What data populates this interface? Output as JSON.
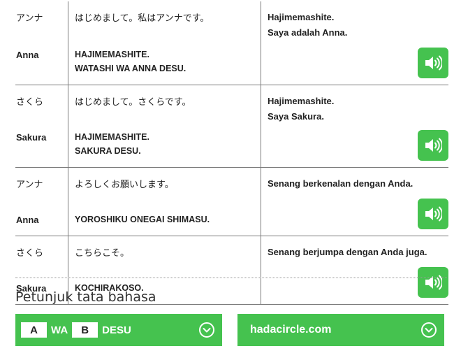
{
  "dialog": {
    "rows": [
      {
        "speaker_jp": "アンナ",
        "speaker_romaji": "Anna",
        "jp": "はじめまして。私はアンナです。",
        "romaji_line1": "HAJIMEMASHITE.",
        "romaji_line2": "WATASHI WA ANNA DESU.",
        "indonesian_line1": "Hajimemashite.",
        "indonesian_line2": "Saya adalah Anna."
      },
      {
        "speaker_jp": "さくら",
        "speaker_romaji": "Sakura",
        "jp": "はじめまして。さくらです。",
        "romaji_line1": "HAJIMEMASHITE.",
        "romaji_line2": "SAKURA DESU.",
        "indonesian_line1": "Hajimemashite.",
        "indonesian_line2": "Saya Sakura."
      },
      {
        "speaker_jp": "アンナ",
        "speaker_romaji": "Anna",
        "jp": "よろしくお願いします。",
        "romaji_line1": "YOROSHIKU ONEGAI SHIMASU.",
        "romaji_line2": "",
        "indonesian_line1": "Senang berkenalan dengan Anda.",
        "indonesian_line2": ""
      },
      {
        "speaker_jp": "さくら",
        "speaker_romaji": "Sakura",
        "jp": "こちらこそ。",
        "romaji_line1": "KOCHIRAKOSO.",
        "romaji_line2": "",
        "indonesian_line1": "Senang berjumpa dengan Anda juga.",
        "indonesian_line2": ""
      }
    ],
    "sound_icon": "speaker-volume-icon"
  },
  "grammar": {
    "title": "Petunjuk tata bahasa",
    "pattern": {
      "box_a": "A",
      "word_wa": "WA",
      "box_b": "B",
      "word_desu": "DESU"
    },
    "site_label": "hadacircle.com",
    "expand_icon": "chevron-circle-down-icon"
  },
  "colors": {
    "accent_green": "#45c24f",
    "divider": "#7a7a7a"
  }
}
